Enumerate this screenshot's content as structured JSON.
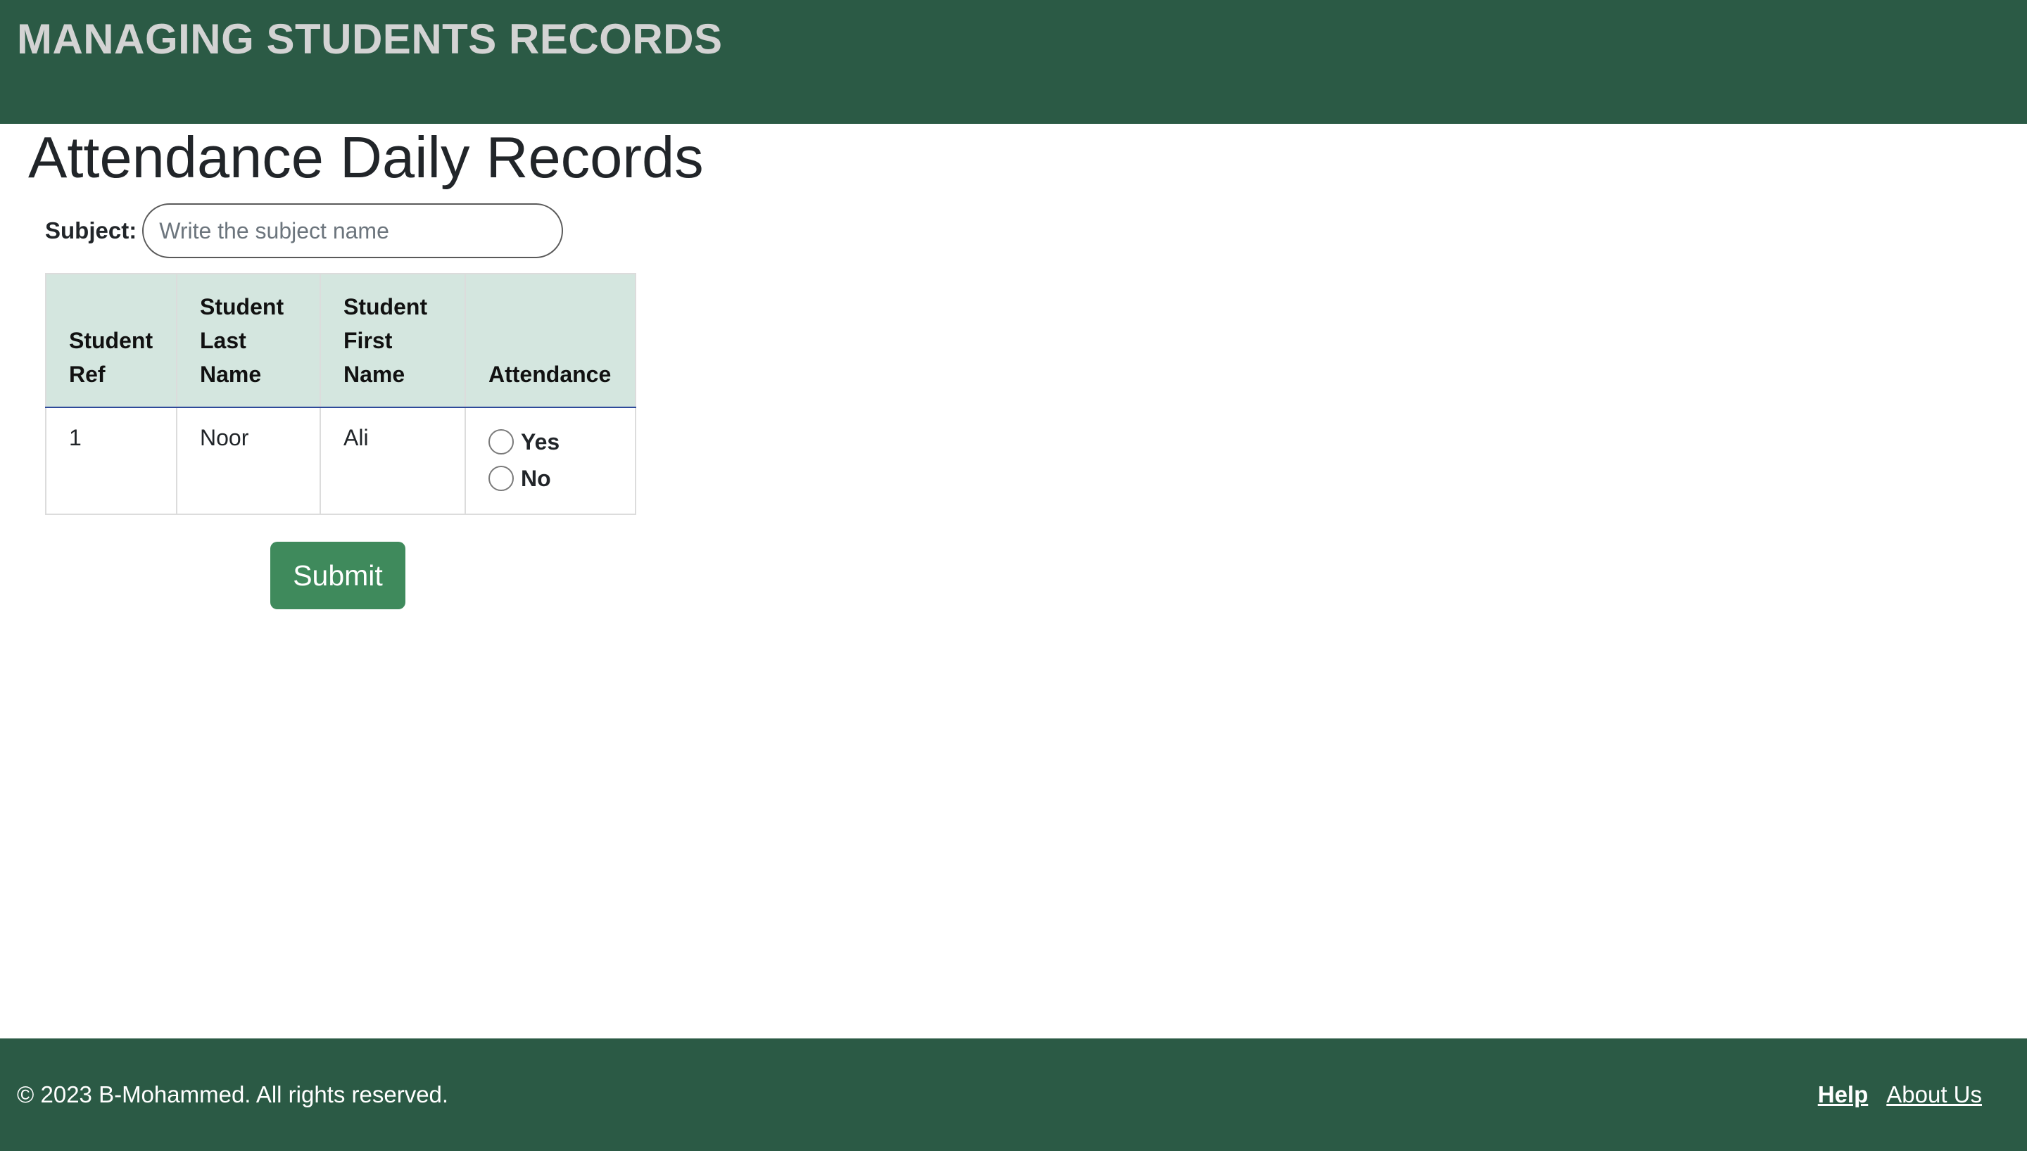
{
  "header": {
    "site_title": "MANAGING STUDENTS RECORDS"
  },
  "main": {
    "page_title": "Attendance Daily Records",
    "subject": {
      "label": "Subject:",
      "value": "",
      "placeholder": "Write the subject name"
    },
    "table": {
      "headers": {
        "ref": [
          "Student",
          "Ref"
        ],
        "last": [
          "Student",
          "Last",
          "Name"
        ],
        "first": [
          "Student",
          "First",
          "Name"
        ],
        "attendance": "Attendance"
      },
      "rows": [
        {
          "ref": "1",
          "last_name": "Noor",
          "first_name": "Ali",
          "options": [
            "Yes",
            "No"
          ],
          "selected": null
        }
      ]
    },
    "submit_label": "Submit"
  },
  "footer": {
    "copyright": "© 2023 B-Mohammed. All rights reserved.",
    "links": [
      "Help",
      "About Us"
    ]
  },
  "colors": {
    "header_bg": "#2b5a45",
    "footer_bg": "#2b5a45",
    "table_header_bg": "#d4e6df",
    "submit_bg": "#3f8a5c",
    "site_title_color": "#d3d3d3"
  }
}
